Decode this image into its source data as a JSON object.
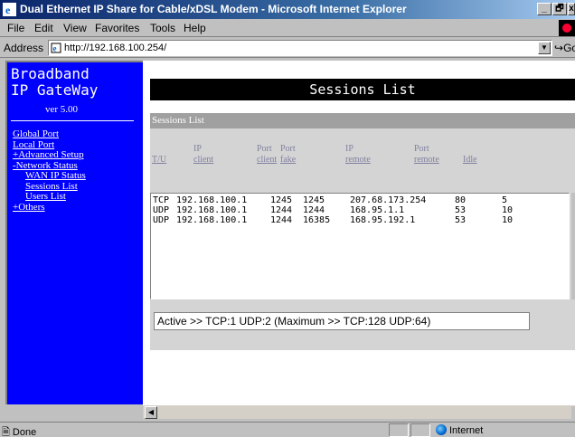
{
  "window": {
    "title": "Dual Ethernet IP Share for Cable/xDSL Modem - Microsoft Internet Explorer",
    "minimize_glyph": "_",
    "restore_glyph": "🗗",
    "close_glyph": "x"
  },
  "menu": {
    "file": "File",
    "edit": "Edit",
    "view": "View",
    "favorites": "Favorites",
    "tools": "Tools",
    "help": "Help"
  },
  "address_bar": {
    "label": "Address",
    "url": "http://192.168.100.254/",
    "go_label": "Go"
  },
  "sidebar": {
    "brand": "Broadband\nIP GateWay",
    "version": "ver 5.00",
    "nav": {
      "global_port": "Global Port",
      "local_port": "Local Port",
      "advanced_setup": "+Advanced Setup",
      "network_status": "-Network Status",
      "wan_ip_status": "WAN IP Status",
      "sessions_list": "Sessions List",
      "users_list": "Users List",
      "others": "+Others"
    }
  },
  "main": {
    "page_title": "Sessions List",
    "panel_title": "Sessions List",
    "columns": {
      "tu": "T/U",
      "ip_client_top": "IP",
      "ip_client_bottom": "client",
      "port_client_top": "Port",
      "port_client_bottom": "client",
      "port_fake_top": "Port",
      "port_fake_bottom": "fake",
      "ip_remote_top": "IP",
      "ip_remote_bottom": "remote",
      "port_remote_top": "Port",
      "port_remote_bottom": "remote",
      "idle": "Idle"
    },
    "sessions": [
      {
        "proto": "TCP",
        "ip_client": "192.168.100.1",
        "port_client": "1245",
        "port_fake": "1245",
        "ip_remote": "207.68.173.254",
        "port_remote": "80",
        "idle": "5"
      },
      {
        "proto": "UDP",
        "ip_client": "192.168.100.1",
        "port_client": "1244",
        "port_fake": "1244",
        "ip_remote": "168.95.1.1",
        "port_remote": "53",
        "idle": "10"
      },
      {
        "proto": "UDP",
        "ip_client": "192.168.100.1",
        "port_client": "1244",
        "port_fake": "16385",
        "ip_remote": "168.95.192.1",
        "port_remote": "53",
        "idle": "10"
      }
    ],
    "summary": "Active >> TCP:1 UDP:2 (Maximum >> TCP:128 UDP:64)"
  },
  "status_bar": {
    "status": "Done",
    "zone": "Internet"
  },
  "colors": {
    "sidebar_bg": "#0000ff",
    "title_gradient_start": "#0a246a",
    "header_bg": "#000000",
    "panel_bg": "#d4d4d4"
  }
}
